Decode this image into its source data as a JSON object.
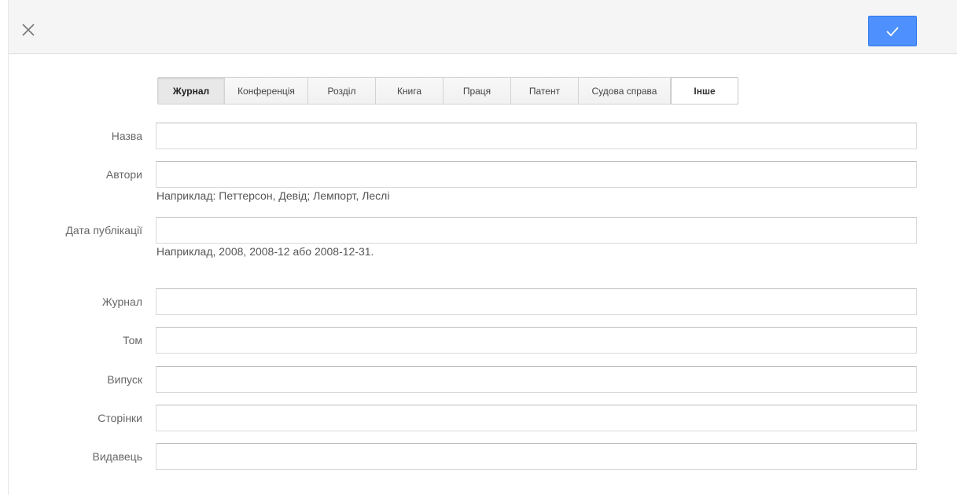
{
  "toolbar": {
    "close_icon": "close-icon",
    "save_icon": "checkmark-icon",
    "save_color": "#4d90fe"
  },
  "tabs": [
    {
      "label": "Журнал",
      "selected": true
    },
    {
      "label": "Конференція",
      "selected": false
    },
    {
      "label": "Розділ",
      "selected": false
    },
    {
      "label": "Книга",
      "selected": false
    },
    {
      "label": "Праця",
      "selected": false
    },
    {
      "label": "Патент",
      "selected": false
    },
    {
      "label": "Судова справа",
      "selected": false
    },
    {
      "label": "Інше",
      "selected": false
    }
  ],
  "fields": {
    "title": {
      "label": "Назва",
      "value": ""
    },
    "authors": {
      "label": "Автори",
      "value": "",
      "hint": "Наприклад: Петтерсон, Девід; Лемпорт, Леслі"
    },
    "date": {
      "label": "Дата публікації",
      "value": "",
      "hint": "Наприклад, 2008, 2008-12 або 2008-12-31."
    },
    "journal": {
      "label": "Журнал",
      "value": ""
    },
    "volume": {
      "label": "Том",
      "value": ""
    },
    "issue": {
      "label": "Випуск",
      "value": ""
    },
    "pages": {
      "label": "Сторінки",
      "value": ""
    },
    "publisher": {
      "label": "Видавець",
      "value": ""
    }
  }
}
